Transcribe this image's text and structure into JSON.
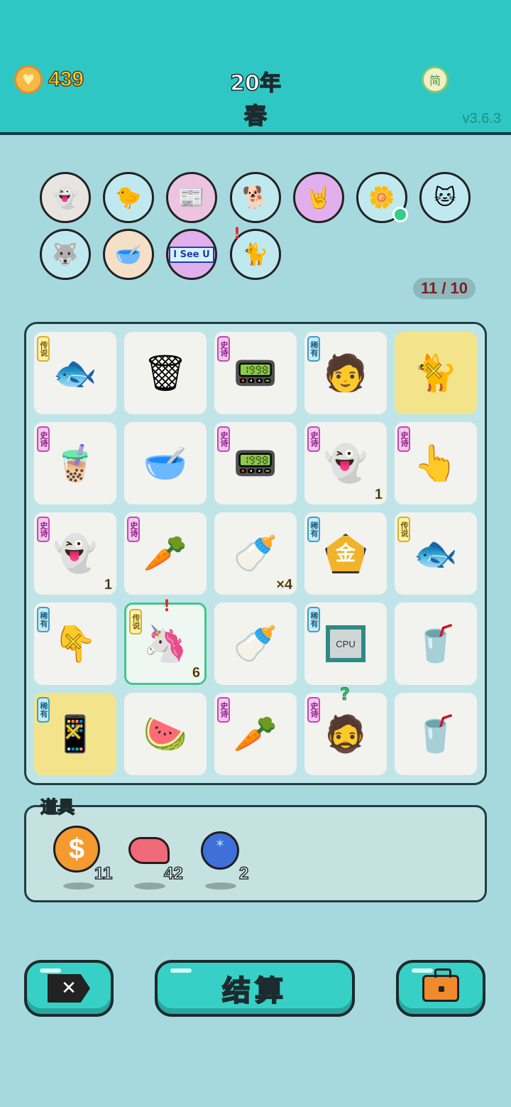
{
  "header": {
    "coins": "439",
    "year": "20年",
    "season": "春",
    "lang_button": "简",
    "version": "v3.6.3"
  },
  "relics": [
    {
      "name": "ghost",
      "icon": "👻"
    },
    {
      "name": "syringe-chick",
      "icon": "🐤"
    },
    {
      "name": "time-magazine",
      "icon": "📰"
    },
    {
      "name": "cool-dog",
      "icon": "🐕"
    },
    {
      "name": "rock-hand",
      "icon": "🤘"
    },
    {
      "name": "flower-pot",
      "icon": "🌼"
    },
    {
      "name": "twin-cats",
      "icon": "🐱"
    },
    {
      "name": "husky",
      "icon": "🐺"
    },
    {
      "name": "dog-bowl",
      "icon": "🥣"
    },
    {
      "name": "i-see-u",
      "icon": "",
      "text": "I See U"
    },
    {
      "name": "hole-cat",
      "icon": "🐈"
    }
  ],
  "relic_count": "11 / 10",
  "board": {
    "tag_labels": {
      "legend": "传说",
      "epic": "史诗",
      "rare": "稀有"
    },
    "cells": [
      {
        "icon": "🐟",
        "tag": "传说",
        "tag_type": "legend"
      },
      {
        "icon": "🗑",
        "tag": "",
        "tag_type": ""
      },
      {
        "icon": "📟",
        "tag": "史诗",
        "tag_type": "epic"
      },
      {
        "icon": "🧑",
        "tag": "稀有",
        "tag_type": "rare"
      },
      {
        "icon": "🐈",
        "tag": "",
        "tag_type": "",
        "highlight": true,
        "marked": true
      },
      {
        "icon": "🧋",
        "tag": "史诗",
        "tag_type": "epic"
      },
      {
        "icon": "🥣",
        "tag": "",
        "tag_type": ""
      },
      {
        "icon": "📟",
        "tag": "史诗",
        "tag_type": "epic"
      },
      {
        "icon": "👻",
        "tag": "史诗",
        "tag_type": "epic",
        "count": "1"
      },
      {
        "icon": "👆",
        "tag": "史诗",
        "tag_type": "epic"
      },
      {
        "icon": "👻",
        "tag": "史诗",
        "tag_type": "epic",
        "count": "1"
      },
      {
        "icon": "🥕",
        "tag": "史诗",
        "tag_type": "epic"
      },
      {
        "icon": "🍼",
        "tag": "",
        "tag_type": "",
        "count": "×4"
      },
      {
        "icon": "金",
        "tag": "稀有",
        "tag_type": "rare"
      },
      {
        "icon": "🐟",
        "tag": "传说",
        "tag_type": "legend"
      },
      {
        "icon": "👇",
        "tag": "稀有",
        "tag_type": "rare",
        "marked": true
      },
      {
        "icon": "🦄",
        "tag": "传说",
        "tag_type": "legend",
        "count": "6",
        "selected": true,
        "alert": true
      },
      {
        "icon": "🍼",
        "tag": "",
        "tag_type": ""
      },
      {
        "icon": "CPU",
        "tag": "稀有",
        "tag_type": "rare"
      },
      {
        "icon": "🥤",
        "tag": "",
        "tag_type": ""
      },
      {
        "icon": "📱",
        "tag": "稀有",
        "tag_type": "rare",
        "highlight": true,
        "marked": true
      },
      {
        "icon": "🍉",
        "tag": "",
        "tag_type": ""
      },
      {
        "icon": "🥕",
        "tag": "史诗",
        "tag_type": "epic"
      },
      {
        "icon": "🧔",
        "tag": "史诗",
        "tag_type": "epic",
        "question": true
      },
      {
        "icon": "🥤",
        "tag": "",
        "tag_type": ""
      }
    ]
  },
  "items": {
    "title": "道具",
    "list": [
      {
        "name": "coin",
        "symbol": "$",
        "count": "11"
      },
      {
        "name": "liver",
        "symbol": "",
        "count": "42"
      },
      {
        "name": "blueberry",
        "symbol": "✶",
        "count": "2"
      }
    ]
  },
  "buttons": {
    "skip": "✕",
    "settle": "结算",
    "bag": ""
  },
  "colors": {
    "header_bg": "#2fc7c4",
    "page_bg": "#a6d9de",
    "accent_button": "#37d0c7"
  }
}
